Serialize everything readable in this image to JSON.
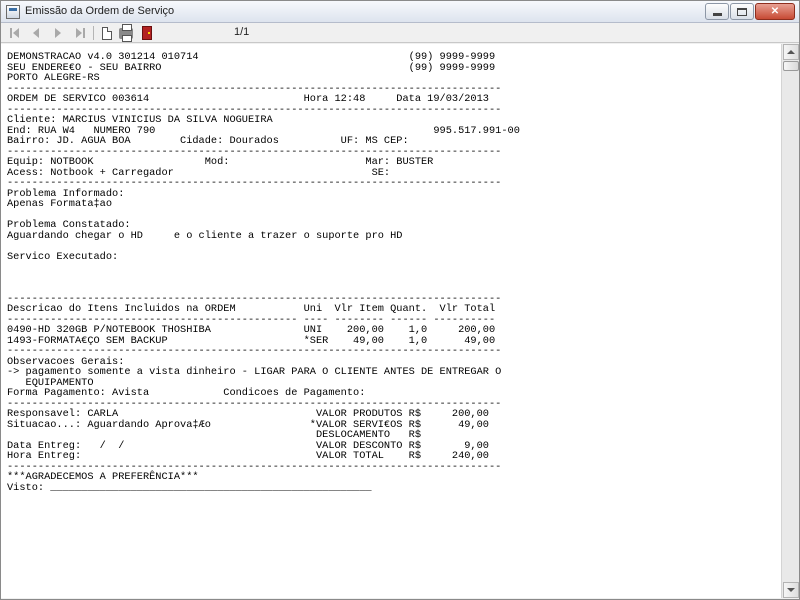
{
  "window": {
    "title": "Emissão da Ordem de Serviço"
  },
  "toolbar": {
    "page_counter": "1/1",
    "icons": [
      "first-page-icon",
      "prev-page-icon",
      "next-page-icon",
      "last-page-icon",
      "new-page-icon",
      "printer-icon",
      "exit-icon"
    ]
  },
  "report": {
    "lines": [
      "DEMONSTRACAO v4.0 301214 010714                                  (99) 9999-9999",
      "SEU ENDERE€O - SEU BAIRRO                                        (99) 9999-9999",
      "PORTO ALEGRE-RS",
      "--------------------------------------------------------------------------------",
      "ORDEM DE SERVICO 003614                         Hora 12:48     Data 19/03/2013",
      "--------------------------------------------------------------------------------",
      "Cliente: MARCIUS VINICIUS DA SILVA NOGUEIRA",
      "End: RUA W4   NUMERO 790                                             995.517.991-00",
      "Bairro: JD. AGUA BOA        Cidade: Dourados          UF: MS CEP:",
      "--------------------------------------------------------------------------------",
      "Equip: NOTBOOK                  Mod:                      Mar: BUSTER",
      "Acess: Notbook + Carregador                                SE:",
      "--------------------------------------------------------------------------------",
      "Problema Informado:",
      "Apenas Formata‡ao",
      "",
      "Problema Constatado:",
      "Aguardando chegar o HD     e o cliente a trazer o suporte pro HD",
      "",
      "Servico Executado:",
      "",
      "",
      "",
      "--------------------------------------------------------------------------------",
      "Descricao do Itens Incluidos na ORDEM           Uni  Vlr Item Quant.  Vlr Total",
      "----------------------------------------------- ---- -------- ------ ----------",
      "0490-HD 320GB P/NOTEBOOK THOSHIBA               UNI    200,00    1,0     200,00",
      "1493-FORMATA€ÇO SEM BACKUP                      *SER    49,00    1,0      49,00",
      "--------------------------------------------------------------------------------",
      "Observacoes Gerais:",
      "-> pagamento somente a vista dinheiro - LIGAR PARA O CLIENTE ANTES DE ENTREGAR O",
      "   EQUIPAMENTO",
      "Forma Pagamento: Avista            Condicoes de Pagamento:",
      "--------------------------------------------------------------------------------",
      "Responsavel: CARLA                                VALOR PRODUTOS R$     200,00",
      "Situacao...: Aguardando Aprova‡Æo                *VALOR SERVI€OS R$      49,00",
      "                                                  DESLOCAMENTO   R$",
      "Data Entreg:   /  /                               VALOR DESCONTO R$       9,00",
      "Hora Entreg:                                      VALOR TOTAL    R$     240,00",
      "--------------------------------------------------------------------------------",
      "***AGRADECEMOS A PREFERÊNCIA***",
      "Visto: ____________________________________________________"
    ]
  }
}
